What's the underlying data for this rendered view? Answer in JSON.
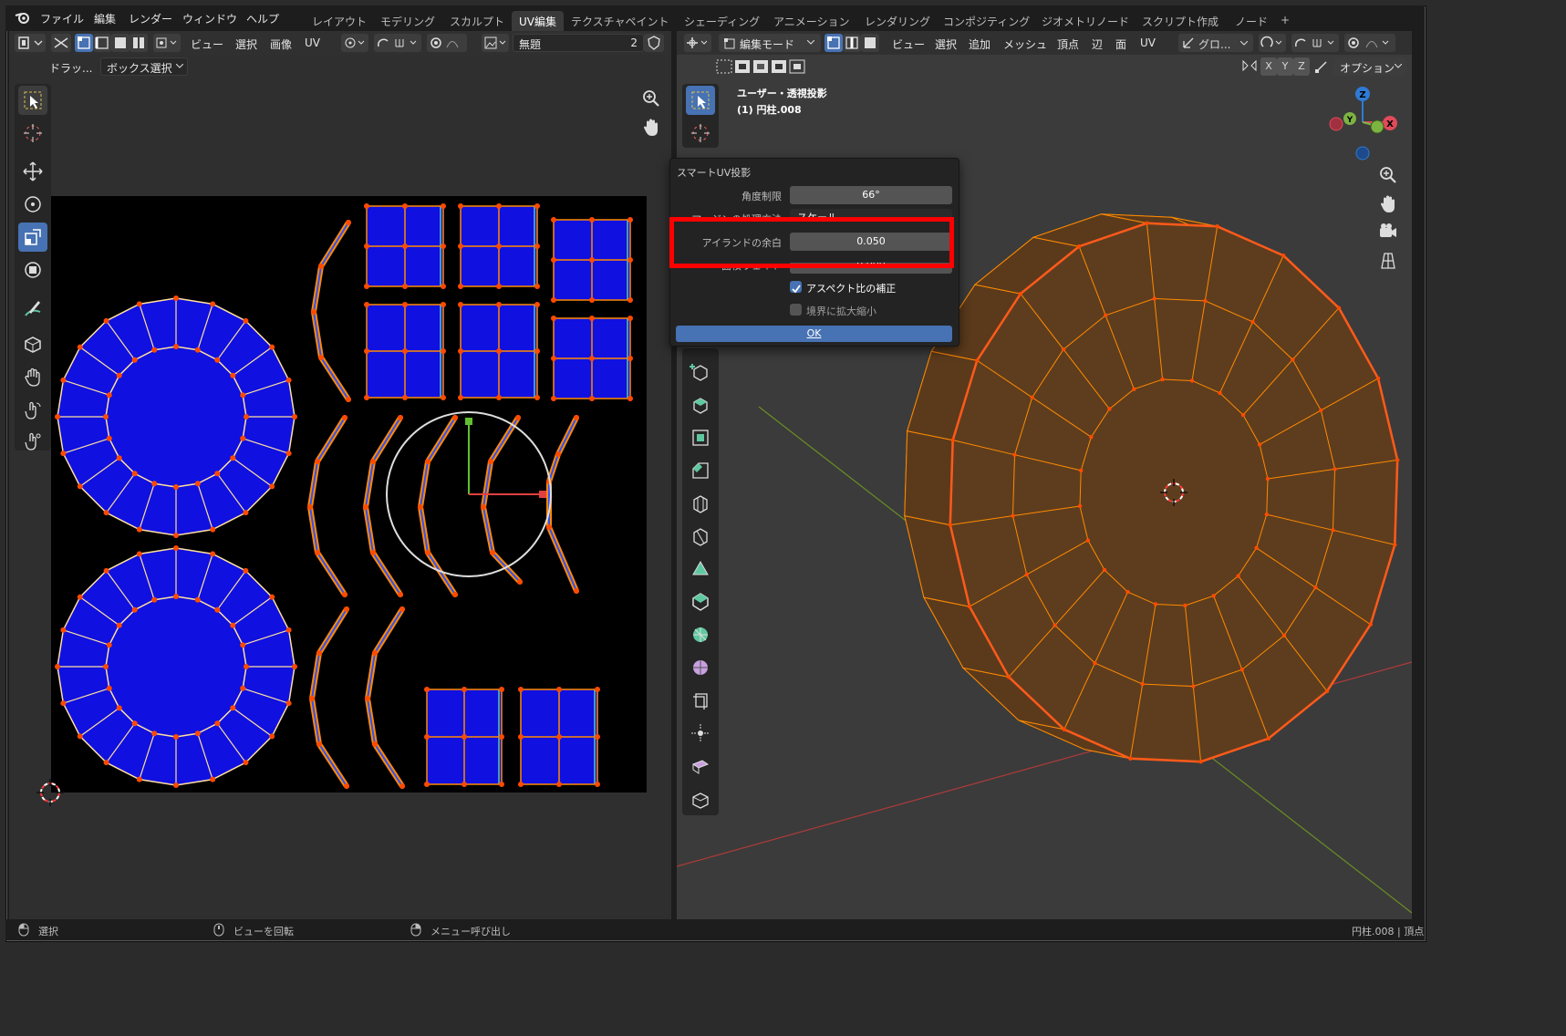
{
  "menu": {
    "items": [
      "ファイル",
      "編集",
      "レンダー",
      "ウィンドウ",
      "ヘルプ"
    ]
  },
  "workspaces": {
    "tabs": [
      "レイアウト",
      "モデリング",
      "スカルプト",
      "UV編集",
      "テクスチャペイント",
      "シェーディング",
      "アニメーション",
      "レンダリング",
      "コンポジティング",
      "ジオメトリノード",
      "スクリプト作成",
      "ノード"
    ],
    "active": "UV編集",
    "add": "+"
  },
  "uv_header": {
    "menus": [
      "ビュー",
      "選択",
      "画像",
      "UV"
    ],
    "image_name": "無題",
    "image_users": "2",
    "drag_label": "ドラッ...",
    "select_mode": "ボックス選択"
  },
  "viewport_header": {
    "mode": "編集モード",
    "menus": [
      "ビュー",
      "選択",
      "追加",
      "メッシュ",
      "頂点",
      "辺",
      "面",
      "UV"
    ],
    "transform": "グロ...",
    "axes": [
      "X",
      "Y",
      "Z"
    ],
    "options": "オプション"
  },
  "viewport_info": {
    "view_name": "ユーザー・透視投影",
    "object_name": "(1) 円柱.008"
  },
  "gizmo": {
    "z": "Z",
    "y": "Y",
    "x": "X"
  },
  "operator_panel": {
    "title": "スマートUV投影",
    "angle_label": "角度制限",
    "angle_value": "66°",
    "margin_method_label": "マージンの処理方法",
    "margin_method_value": "スケール",
    "island_margin_label": "アイランドの余白",
    "island_margin_value": "0.050",
    "area_weight_label": "面積ウェイト",
    "area_weight_value": "0.000",
    "correct_aspect_label": "アスペクト比の補正",
    "correct_aspect_checked": true,
    "scale_to_bounds_label": "境界に拡大縮小",
    "scale_to_bounds_checked": false,
    "ok_label": "OK"
  },
  "status": {
    "select": "選択",
    "rotate": "ビューを回転",
    "menu": "メニュー呼び出し",
    "right": "円柱.008 | 頂点"
  },
  "colors": {
    "accent": "#4772b3",
    "uv_face": "#1010e0",
    "vertex": "#ff4a00",
    "edge": "#ff8a00",
    "mesh_fill": "#5b3a1c",
    "highlight": "#ff0000"
  }
}
